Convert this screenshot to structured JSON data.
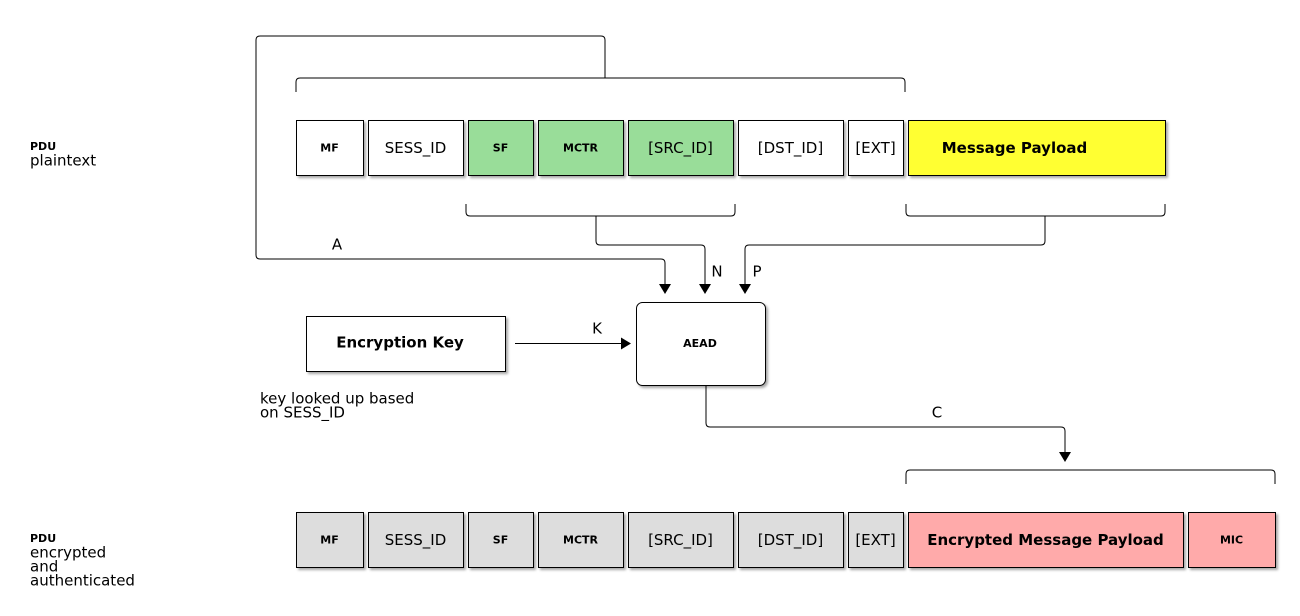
{
  "colors": {
    "plain": "#ffffff",
    "authenticated": "#99dd99",
    "payload": "#ffff33",
    "encrypted_header": "#dddddd",
    "ciphertext": "#ffaaaa"
  },
  "labels": {
    "top": [
      "PDU",
      "plaintext"
    ],
    "bottom": [
      "PDU",
      "encrypted",
      "and",
      "authenticated"
    ],
    "key_note": [
      "key looked up based",
      " on SESS_ID"
    ]
  },
  "top_row": [
    {
      "label": "MF",
      "fill": "plain",
      "small": true
    },
    {
      "label": "SESS_ID",
      "fill": "plain",
      "small": false
    },
    {
      "label": "SF",
      "fill": "authenticated",
      "small": true
    },
    {
      "label": "MCTR",
      "fill": "authenticated",
      "small": true
    },
    {
      "label": "[SRC_ID]",
      "fill": "authenticated",
      "small": false
    },
    {
      "label": "[DST_ID]",
      "fill": "plain",
      "small": false
    },
    {
      "label": "[EXT]",
      "fill": "plain",
      "small": false
    },
    {
      "label": "Message Payload",
      "fill": "payload",
      "small": false,
      "bold": true
    }
  ],
  "bottom_row": [
    {
      "label": "MF",
      "fill": "encrypted_header",
      "small": true
    },
    {
      "label": "SESS_ID",
      "fill": "encrypted_header",
      "small": false
    },
    {
      "label": "SF",
      "fill": "encrypted_header",
      "small": true
    },
    {
      "label": "MCTR",
      "fill": "encrypted_header",
      "small": true
    },
    {
      "label": "[SRC_ID]",
      "fill": "encrypted_header",
      "small": false
    },
    {
      "label": "[DST_ID]",
      "fill": "encrypted_header",
      "small": false
    },
    {
      "label": "[EXT]",
      "fill": "encrypted_header",
      "small": false
    },
    {
      "label": "Encrypted Message Payload",
      "fill": "ciphertext",
      "small": false,
      "bold": true
    },
    {
      "label": "MIC",
      "fill": "ciphertext",
      "small": true
    }
  ],
  "key_box": "Encryption Key",
  "aead_box": "AEAD",
  "edges": {
    "A": "A",
    "N": "N",
    "P": "P",
    "K": "K",
    "C": "C"
  }
}
